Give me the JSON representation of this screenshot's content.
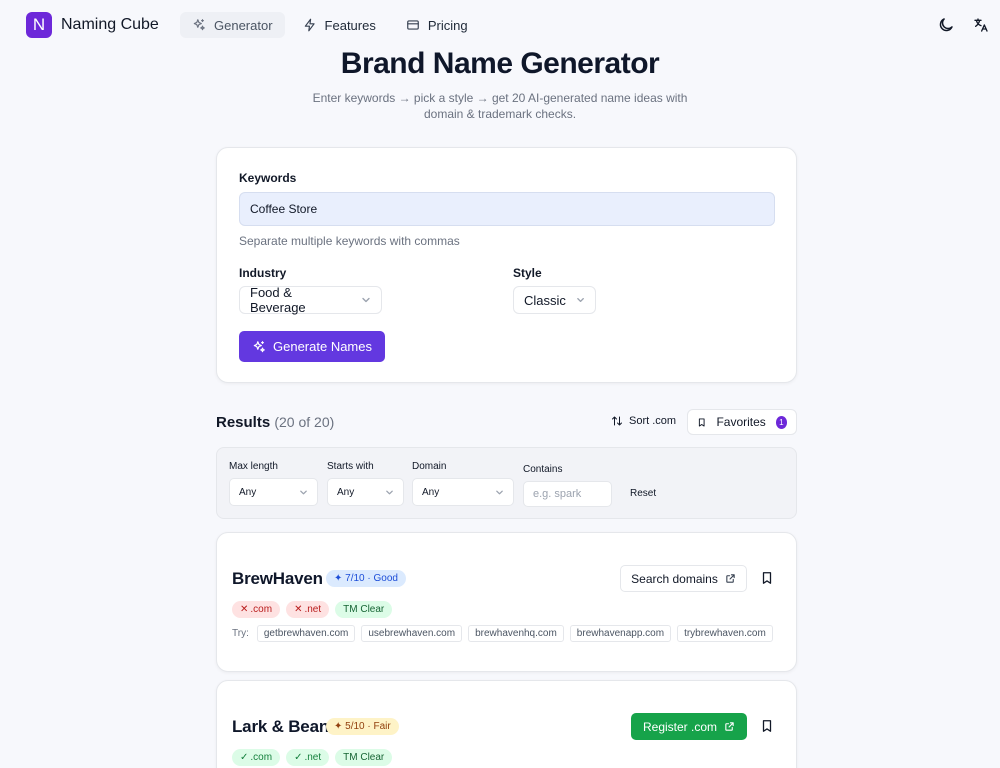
{
  "header": {
    "logo_letter": "N",
    "brand": "Naming Cube",
    "nav": [
      {
        "label": "Generator",
        "icon": "sparkles-icon",
        "active": true
      },
      {
        "label": "Features",
        "icon": "bolt-icon"
      },
      {
        "label": "Pricing",
        "icon": "card-icon"
      }
    ],
    "icons": [
      "moon-icon",
      "translate-icon"
    ]
  },
  "hero": {
    "title": "Brand Name Generator",
    "subtitle": "Enter keywords → pick a style → get 20 AI-generated name ideas with domain & trademark checks."
  },
  "form": {
    "keywords_label": "Keywords",
    "keywords_value": "Coffee Store",
    "keywords_help": "Separate multiple keywords with commas",
    "industry_label": "Industry",
    "industry_value": "Food & Beverage",
    "style_label": "Style",
    "style_value": "Classic",
    "generate_label": "Generate Names"
  },
  "results": {
    "title": "Results",
    "count": "(20 of 20)",
    "sort_label": "Sort .com",
    "favorites_label": "Favorites",
    "favorites_count": "1"
  },
  "filters": {
    "max_length": {
      "label": "Max length",
      "value": "Any"
    },
    "starts_with": {
      "label": "Starts with",
      "value": "Any"
    },
    "domain": {
      "label": "Domain",
      "value": "Any"
    },
    "contains": {
      "label": "Contains",
      "placeholder": "e.g. spark"
    },
    "reset_label": "Reset"
  },
  "cards": [
    {
      "name": "BrewHaven",
      "score": "✦ 7/10 · Good",
      "score_status": "good",
      "chips": [
        {
          "label": ".com",
          "mark": "✕",
          "status": "bad"
        },
        {
          "label": ".net",
          "mark": "✕",
          "status": "bad"
        },
        {
          "label": "TM Clear",
          "mark": "",
          "status": "tm"
        }
      ],
      "try_label": "Try:",
      "suggestions": [
        "getbrewhaven.com",
        "usebrewhaven.com",
        "brewhavenhq.com",
        "brewhavenapp.com",
        "trybrewhaven.com"
      ],
      "action_label": "Search domains",
      "action_style": "outline"
    },
    {
      "name": "Lark & Bean",
      "score": "✦ 5/10 · Fair",
      "score_status": "fair",
      "chips": [
        {
          "label": ".com",
          "mark": "✓",
          "status": "ok"
        },
        {
          "label": ".net",
          "mark": "✓",
          "status": "ok"
        },
        {
          "label": "TM Clear",
          "mark": "",
          "status": "tm"
        }
      ],
      "action_label": "Register .com",
      "action_style": "green"
    }
  ],
  "colors": {
    "accent": "#6338e0",
    "logo": "#6d28d9",
    "success": "#16a34a",
    "danger": "#b91c1c"
  }
}
